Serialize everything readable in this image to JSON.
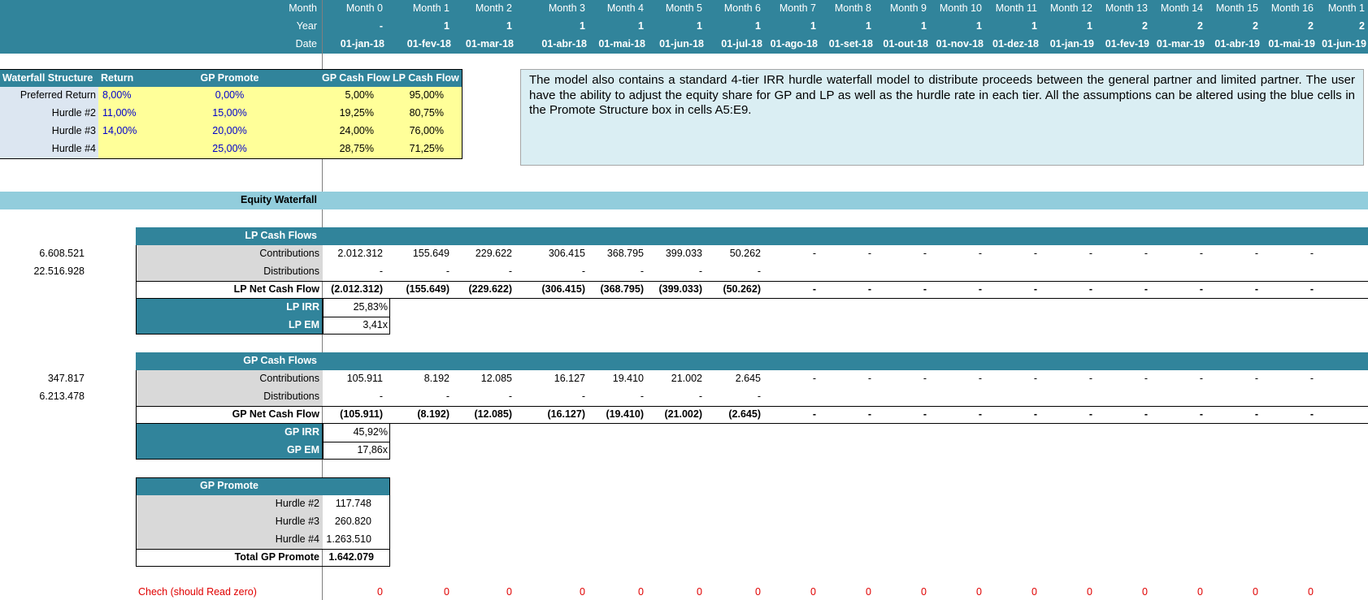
{
  "timeline": {
    "labels": {
      "month": "Month",
      "year": "Year",
      "date": "Date"
    },
    "months": [
      "Month 0",
      "Month 1",
      "Month 2",
      "Month 3",
      "Month 4",
      "Month 5",
      "Month 6",
      "Month 7",
      "Month 8",
      "Month 9",
      "Month 10",
      "Month 11",
      "Month 12",
      "Month 13",
      "Month 14",
      "Month 15",
      "Month 16",
      "Month 1"
    ],
    "years": [
      "-",
      "1",
      "1",
      "1",
      "1",
      "1",
      "1",
      "1",
      "1",
      "1",
      "1",
      "1",
      "1",
      "2",
      "2",
      "2",
      "2",
      "2"
    ],
    "dates": [
      "01-jan-18",
      "01-fev-18",
      "01-mar-18",
      "01-abr-18",
      "01-mai-18",
      "01-jun-18",
      "01-jul-18",
      "01-ago-18",
      "01-set-18",
      "01-out-18",
      "01-nov-18",
      "01-dez-18",
      "01-jan-19",
      "01-fev-19",
      "01-mar-19",
      "01-abr-19",
      "01-mai-19",
      "01-jun-19"
    ]
  },
  "waterfall": {
    "headers": {
      "structure": "Waterfall Structure",
      "return": "Return",
      "gp_promote": "GP Promote",
      "gp_cf": "GP Cash Flow",
      "lp_cf": "LP Cash Flow"
    },
    "rows": [
      {
        "name": "Preferred Return",
        "ret": "8,00%",
        "promote": "0,00%",
        "gp": "5,00%",
        "lp": "95,00%"
      },
      {
        "name": "Hurdle #2",
        "ret": "11,00%",
        "promote": "15,00%",
        "gp": "19,25%",
        "lp": "80,75%"
      },
      {
        "name": "Hurdle #3",
        "ret": "14,00%",
        "promote": "20,00%",
        "gp": "24,00%",
        "lp": "76,00%"
      },
      {
        "name": "Hurdle #4",
        "ret": "",
        "promote": "25,00%",
        "gp": "28,75%",
        "lp": "71,25%"
      }
    ]
  },
  "note": "The model also contains a standard 4-tier IRR hurdle waterfall model to distribute proceeds between the general partner and limited partner. The user have the ability to adjust the equity share for GP and LP as well as the hurdle rate in each tier. All the assumptions can be altered using the blue cells in the Promote Structure box in cells A5:E9.",
  "equity_waterfall_title": "Equity Waterfall",
  "lp": {
    "title": "LP Cash Flows",
    "contrib_total": "6.608.521",
    "distrib_total": "22.516.928",
    "contrib_label": "Contributions",
    "distrib_label": "Distributions",
    "net_label": "LP Net Cash Flow",
    "irr_label": "LP IRR",
    "irr": "25,83%",
    "em_label": "LP EM",
    "em": "3,41x",
    "contrib": [
      "2.012.312",
      "155.649",
      "229.622",
      "306.415",
      "368.795",
      "399.033",
      "50.262",
      "-",
      "-",
      "-",
      "-",
      "-",
      "-",
      "-",
      "-",
      "-",
      "-"
    ],
    "distrib": [
      "-",
      "-",
      "-",
      "-",
      "-",
      "-",
      "-",
      "",
      "",
      "",
      "",
      "",
      "",
      "",
      "",
      "",
      ""
    ],
    "net": [
      "(2.012.312)",
      "(155.649)",
      "(229.622)",
      "(306.415)",
      "(368.795)",
      "(399.033)",
      "(50.262)",
      "-",
      "-",
      "-",
      "-",
      "-",
      "-",
      "-",
      "-",
      "-",
      "-"
    ]
  },
  "gp": {
    "title": "GP Cash Flows",
    "contrib_total": "347.817",
    "distrib_total": "6.213.478",
    "contrib_label": "Contributions",
    "distrib_label": "Distributions",
    "net_label": "GP Net Cash Flow",
    "irr_label": "GP IRR",
    "irr": "45,92%",
    "em_label": "GP EM",
    "em": "17,86x",
    "contrib": [
      "105.911",
      "8.192",
      "12.085",
      "16.127",
      "19.410",
      "21.002",
      "2.645",
      "-",
      "-",
      "-",
      "-",
      "-",
      "-",
      "-",
      "-",
      "-",
      "-"
    ],
    "distrib": [
      "-",
      "-",
      "-",
      "-",
      "-",
      "-",
      "-",
      "",
      "",
      "",
      "",
      "",
      "",
      "",
      "",
      "",
      ""
    ],
    "net": [
      "(105.911)",
      "(8.192)",
      "(12.085)",
      "(16.127)",
      "(19.410)",
      "(21.002)",
      "(2.645)",
      "-",
      "-",
      "-",
      "-",
      "-",
      "-",
      "-",
      "-",
      "-",
      "-"
    ]
  },
  "promote": {
    "title": "GP Promote",
    "rows": [
      {
        "label": "Hurdle #2",
        "value": "117.748"
      },
      {
        "label": "Hurdle #3",
        "value": "260.820"
      },
      {
        "label": "Hurdle #4",
        "value": "1.263.510"
      }
    ],
    "total_label": "Total GP Promote",
    "total": "1.642.079"
  },
  "check": {
    "label": "Chech (should Read zero)",
    "values": [
      "0",
      "0",
      "0",
      "0",
      "0",
      "0",
      "0",
      "0",
      "0",
      "0",
      "0",
      "0",
      "0",
      "0",
      "0",
      "0",
      "0"
    ]
  },
  "colors": {
    "teal": "#31849b",
    "light_teal": "#92cddc",
    "yellow": "#ffff99",
    "note_bg": "#daeef3",
    "grey": "#d9d9d9",
    "header_bg": "#dce6f1"
  }
}
